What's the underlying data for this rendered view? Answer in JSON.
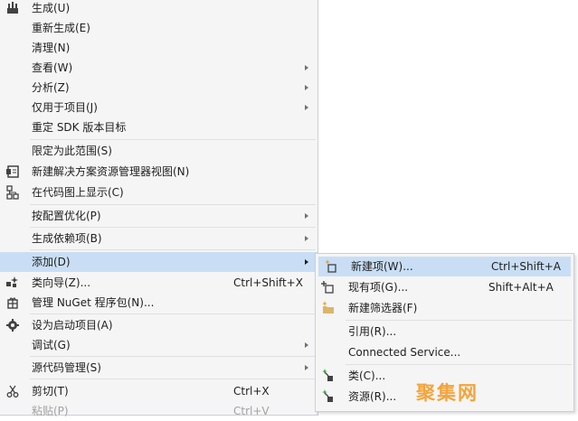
{
  "main_menu": {
    "items": [
      {
        "label": "生成(U)",
        "icon": "build-icon"
      },
      {
        "label": "重新生成(E)"
      },
      {
        "label": "清理(N)"
      },
      {
        "label": "查看(W)",
        "submenu": true
      },
      {
        "label": "分析(Z)",
        "submenu": true
      },
      {
        "label": "仅用于项目(J)",
        "submenu": true
      },
      {
        "label": "重定 SDK 版本目标"
      },
      {
        "label": "限定为此范围(S)"
      },
      {
        "label": "新建解决方案资源管理器视图(N)",
        "icon": "new-explorer-view-icon"
      },
      {
        "label": "在代码图上显示(C)",
        "icon": "code-map-icon"
      },
      {
        "label": "按配置优化(P)",
        "submenu": true
      },
      {
        "label": "生成依赖项(B)",
        "submenu": true
      },
      {
        "label": "添加(D)",
        "submenu": true,
        "highlighted": true
      },
      {
        "label": "类向导(Z)...",
        "shortcut": "Ctrl+Shift+X",
        "icon": "class-wizard-icon"
      },
      {
        "label": "管理 NuGet 程序包(N)...",
        "icon": "nuget-icon"
      },
      {
        "label": "设为启动项目(A)",
        "icon": "startup-gear-icon"
      },
      {
        "label": "调试(G)",
        "submenu": true
      },
      {
        "label": "源代码管理(S)",
        "submenu": true
      },
      {
        "label": "剪切(T)",
        "shortcut": "Ctrl+X",
        "icon": "scissors-icon"
      },
      {
        "label": "粘贴(P)",
        "shortcut": "Ctrl+V",
        "disabled": true
      }
    ]
  },
  "add_submenu": {
    "items": [
      {
        "label": "新建项(W)...",
        "shortcut": "Ctrl+Shift+A",
        "icon": "new-item-icon",
        "highlighted": true
      },
      {
        "label": "现有项(G)...",
        "shortcut": "Shift+Alt+A",
        "icon": "existing-item-icon"
      },
      {
        "label": "新建筛选器(F)",
        "icon": "new-filter-folder-icon"
      },
      {
        "label": "引用(R)..."
      },
      {
        "label": "Connected Service..."
      },
      {
        "label": "类(C)...",
        "icon": "class-icon"
      },
      {
        "label": "资源(R)...",
        "icon": "resource-icon"
      }
    ]
  },
  "watermark": "聚集网",
  "colors": {
    "menu_bg": "#f5f5f5",
    "highlight": "#c9def5",
    "separator": "#e0e0e0",
    "border": "#cccedb",
    "text": "#1e1e1e",
    "watermark": "#f3a43b"
  }
}
